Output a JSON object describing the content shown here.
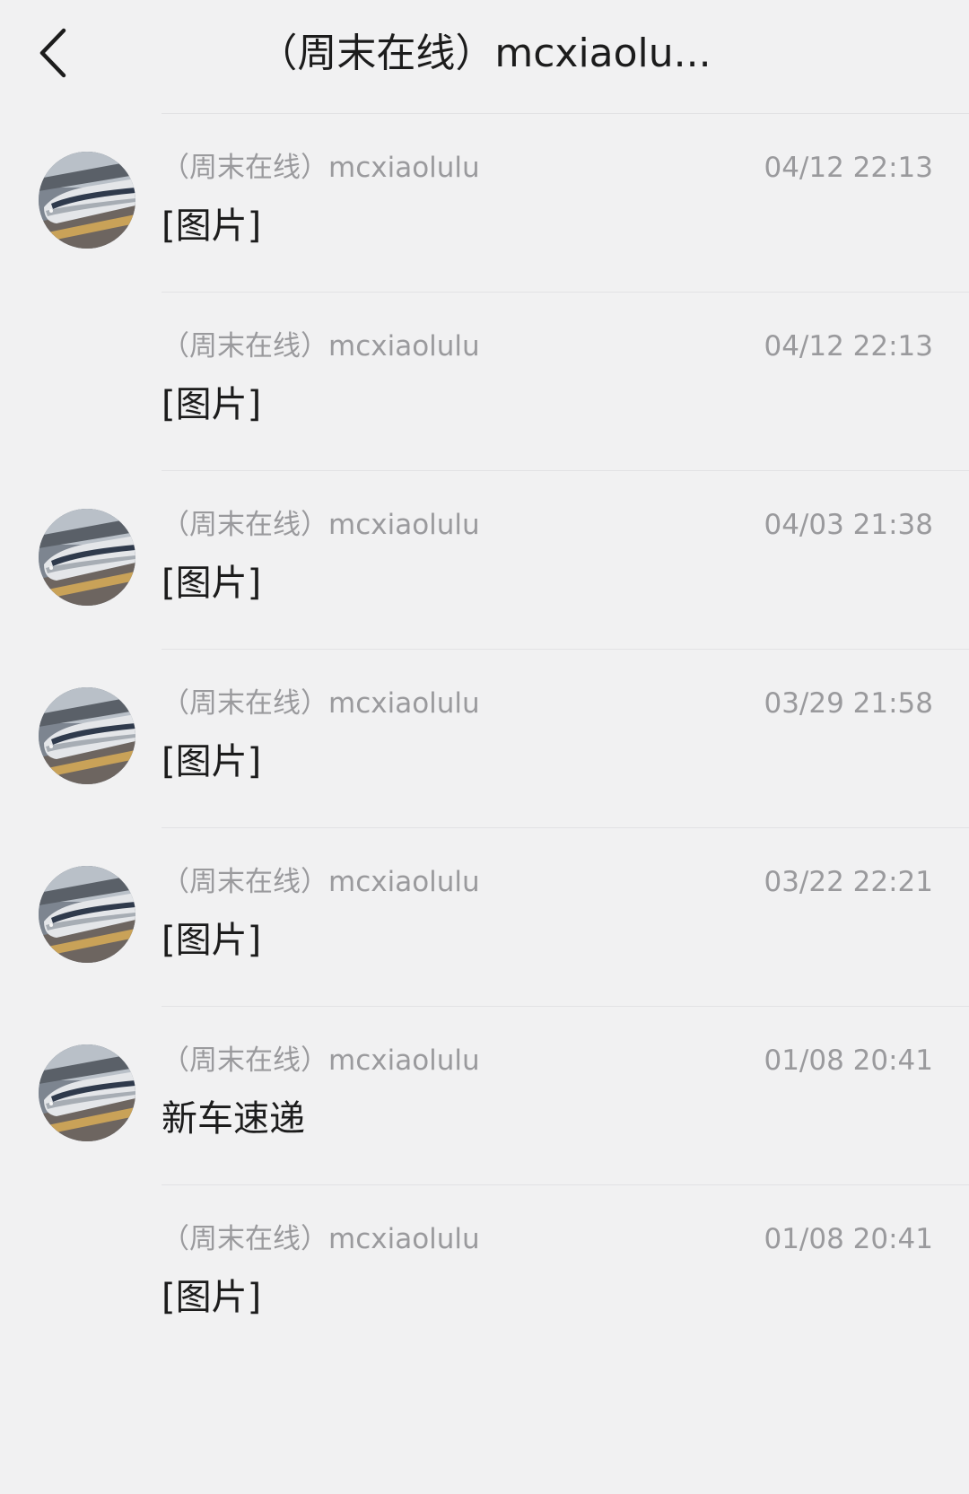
{
  "header": {
    "back_icon": "chevron-left-icon",
    "title": "（周末在线）mcxiaolu..."
  },
  "avatar_icon": "train-photo-avatar",
  "messages": [
    {
      "sender": "（周末在线）mcxiaolulu",
      "time": "04/12 22:13",
      "text": "[图片]",
      "show_avatar": true
    },
    {
      "sender": "（周末在线）mcxiaolulu",
      "time": "04/12 22:13",
      "text": "[图片]",
      "show_avatar": false
    },
    {
      "sender": "（周末在线）mcxiaolulu",
      "time": "04/03 21:38",
      "text": "[图片]",
      "show_avatar": true
    },
    {
      "sender": "（周末在线）mcxiaolulu",
      "time": "03/29 21:58",
      "text": "[图片]",
      "show_avatar": true
    },
    {
      "sender": "（周末在线）mcxiaolulu",
      "time": "03/22 22:21",
      "text": "[图片]",
      "show_avatar": true
    },
    {
      "sender": "（周末在线）mcxiaolulu",
      "time": "01/08 20:41",
      "text": "新车速递",
      "show_avatar": true
    },
    {
      "sender": "（周末在线）mcxiaolulu",
      "time": "01/08 20:41",
      "text": "[图片]",
      "show_avatar": false
    }
  ]
}
